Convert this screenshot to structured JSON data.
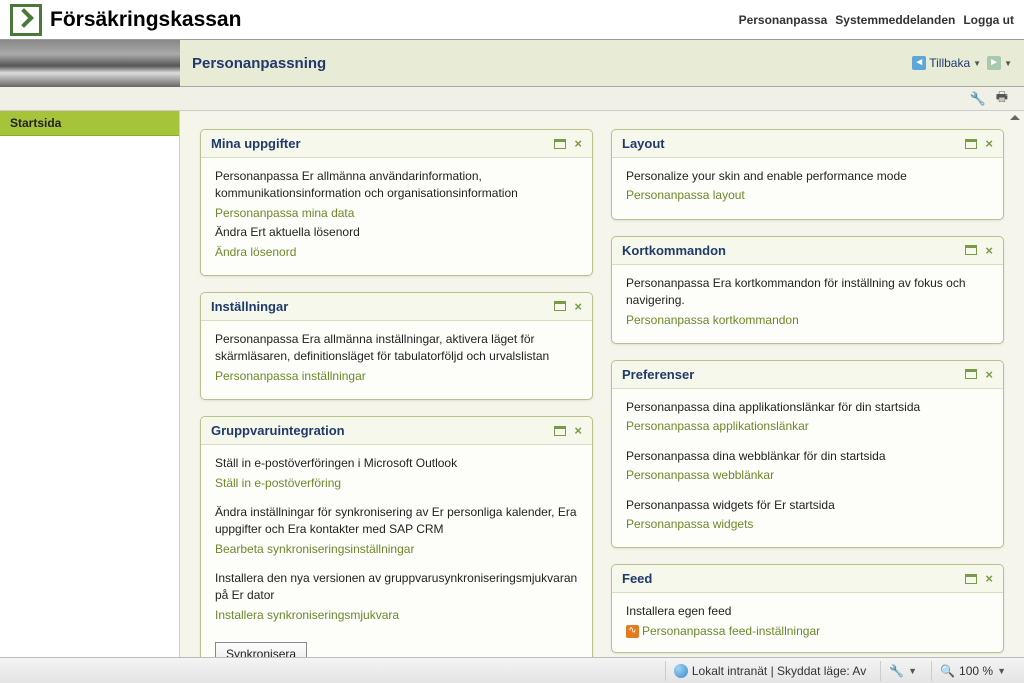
{
  "site": {
    "name": "Försäkringskassan"
  },
  "toplinks": {
    "personalize": "Personanpassa",
    "sysmsg": "Systemmeddelanden",
    "logout": "Logga ut"
  },
  "header": {
    "title": "Personanpassning",
    "back_label": "Tillbaka"
  },
  "sidebar": {
    "startsida": "Startsida"
  },
  "panels": {
    "mina": {
      "title": "Mina uppgifter",
      "desc1": "Personanpassa Er allmänna användarinformation, kommunikationsinformation och organisationsinformation",
      "link1": "Personanpassa mina data",
      "desc2": "Ändra Ert aktuella lösenord",
      "link2": "Ändra lösenord"
    },
    "inst": {
      "title": "Inställningar",
      "desc": "Personanpassa Era allmänna inställningar, aktivera läget för skärmläsaren, definitionsläget för tabulatorföljd och urvalslistan",
      "link": "Personanpassa inställningar"
    },
    "grupp": {
      "title": "Gruppvaruintegration",
      "desc1": "Ställ in e-postöverföringen i Microsoft Outlook",
      "link1": "Ställ in e-postöverföring",
      "desc2": "Ändra inställningar för synkronisering av Er personliga kalender, Era uppgifter och Era kontakter med SAP CRM",
      "link2": "Bearbeta synkroniseringsinställningar",
      "desc3": "Installera den nya versionen av gruppvarusynkroniseringsmjukvaran på Er dator",
      "link3": "Installera synkroniseringsmjukvara",
      "button": "Synkronisera"
    },
    "layout": {
      "title": "Layout",
      "desc": "Personalize your skin and enable performance mode",
      "link": "Personanpassa layout"
    },
    "kort": {
      "title": "Kortkommandon",
      "desc": "Personanpassa Era kortkommandon för inställning av fokus och navigering.",
      "link": "Personanpassa kortkommandon"
    },
    "pref": {
      "title": "Preferenser",
      "desc1": "Personanpassa dina applikationslänkar för din startsida",
      "link1": "Personanpassa applikationslänkar",
      "desc2": "Personanpassa dina webblänkar för din startsida",
      "link2": "Personanpassa webblänkar",
      "desc3": "Personanpassa widgets för Er startsida",
      "link3": "Personanpassa widgets"
    },
    "feed": {
      "title": "Feed",
      "desc": "Installera egen feed",
      "link": "Personanpassa feed-inställningar"
    }
  },
  "status": {
    "zone": "Lokalt intranät | Skyddat läge: Av",
    "zoom": "100 %"
  }
}
